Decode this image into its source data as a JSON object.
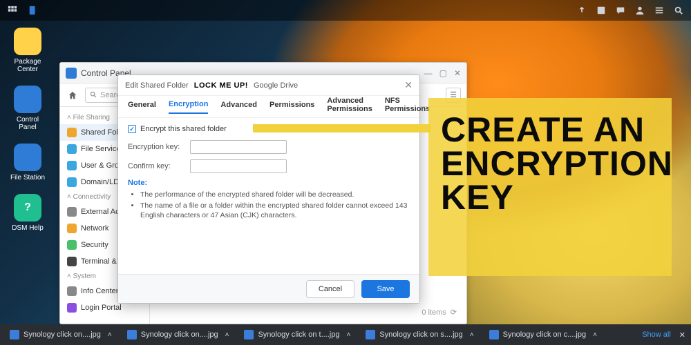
{
  "desktop_icons": [
    {
      "label": "Package Center",
      "color": "#ffd24a"
    },
    {
      "label": "Control Panel",
      "color": "#2e7cd6"
    },
    {
      "label": "File Station",
      "color": "#2e7cd6"
    },
    {
      "label": "DSM Help",
      "color": "#1fbf8f"
    }
  ],
  "control_panel": {
    "title": "Control Panel",
    "search_placeholder": "Search",
    "groups": {
      "file_sharing": {
        "label": "File Sharing",
        "items": [
          "Shared Folder",
          "File Services",
          "User & Group",
          "Domain/LDAP"
        ]
      },
      "connectivity": {
        "label": "Connectivity",
        "items": [
          "External Access",
          "Network",
          "Security",
          "Terminal & SNMP"
        ]
      },
      "system": {
        "label": "System",
        "items": [
          "Info Center",
          "Login Portal"
        ]
      }
    },
    "status_items": "0 items"
  },
  "dialog": {
    "title": "Edit Shared Folder",
    "annotation": "LOCK ME UP!",
    "subtitle": "Google Drive",
    "tabs": [
      "General",
      "Encryption",
      "Advanced",
      "Permissions",
      "Advanced Permissions",
      "NFS Permissions"
    ],
    "active_tab": "Encryption",
    "encrypt_checkbox": "Encrypt this shared folder",
    "field_key": "Encryption key:",
    "field_confirm": "Confirm key:",
    "note_heading": "Note:",
    "notes": [
      "The performance of the encrypted shared folder will be decreased.",
      "The name of a file or a folder within the encrypted shared folder cannot exceed 143 English characters or 47 Asian (CJK) characters."
    ],
    "cancel": "Cancel",
    "save": "Save"
  },
  "callout": "CREATE AN ENCRYPTION KEY",
  "downloads": {
    "items": [
      "Synology click on....jpg",
      "Synology click on....jpg",
      "Synology click on t....jpg",
      "Synology click on s....jpg",
      "Synology click on c....jpg"
    ],
    "show_all": "Show all"
  }
}
